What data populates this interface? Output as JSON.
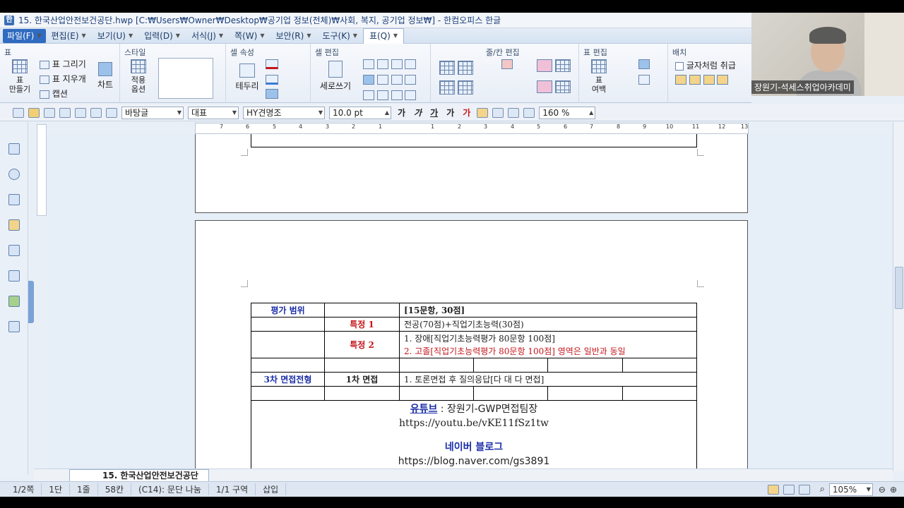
{
  "window": {
    "title": "15. 한국산업안전보건공단.hwp [C:₩Users₩Owner₩Desktop₩공기업 정보(전체)₩사회, 복지, 공기업 정보₩] - 한컴오피스 한글",
    "app_icon": "한"
  },
  "menubar": {
    "file": "파일(F)",
    "items": [
      "편집(E)",
      "보기(U)",
      "입력(D)",
      "서식(J)",
      "쪽(W)",
      "보안(R)",
      "도구(K)"
    ],
    "active": "표(Q)"
  },
  "ribbon": {
    "groups": [
      "표",
      "스타일",
      "셀 속성",
      "셀 편집",
      "줄/칸 편집",
      "표 편집",
      "배치"
    ],
    "table_make": "표\n만들기",
    "draw_table": "표 그리기",
    "erase_table": "표 지우개",
    "caption": "캡션",
    "chart": "차트",
    "apply_options": "적용\n옵션",
    "border": "테두리",
    "vertical_write": "세로쓰기",
    "table_margin": "표\n여백",
    "treat_as_char": "글자처럼 취급"
  },
  "toolbar": {
    "style": "바탕글",
    "language": "대표",
    "font": "HY견명조",
    "size": "10.0",
    "size_unit": "pt",
    "line_spacing": "160",
    "line_spacing_unit": "%",
    "format_buttons": [
      "가",
      "가",
      "가",
      "가",
      "가"
    ]
  },
  "ruler": {
    "ticks": [
      "7",
      "6",
      "5",
      "4",
      "3",
      "2",
      "1",
      "1",
      "2",
      "3",
      "4",
      "5",
      "6",
      "7",
      "8",
      "9",
      "10",
      "11",
      "12",
      "13"
    ]
  },
  "document": {
    "table": {
      "rows": [
        [
          "평가 범위",
          "",
          "[15문항, 30점]"
        ],
        [
          "",
          "특정 1",
          "전공(70점)+직업기초능력(30점)"
        ],
        [
          "",
          "특정 2",
          "1. 장애[직업기초능력평가 80문항 100점]",
          "2. 고졸[직업기초능력평가 80문항 100점] 영역은 일반과 동일"
        ],
        [
          "3차 면접전형",
          "1차 면접",
          "1. 토론면접 후 질의응답[다 대 다 면접]"
        ]
      ]
    },
    "youtube_label": "유튜브",
    "youtube_sep": " : ",
    "youtube_title": "장원기-GWP면접팀장",
    "youtube_url": "https://youtu.be/vKE11fSz1tw",
    "blog_label": "네이버 블로그",
    "blog_url": "https://blog.naver.com/gs3891"
  },
  "doc_tab": "15. 한국산업안전보건공단",
  "statusbar": {
    "page": "1/2쪽",
    "column": "1단",
    "line": "1줄",
    "char": "58칸",
    "code": "(C14): 문단 나눔",
    "section": "1/1 구역",
    "mode": "삽입",
    "zoom": "105%"
  },
  "webcam": {
    "caption": "장원기-석세스취업아카데미"
  }
}
